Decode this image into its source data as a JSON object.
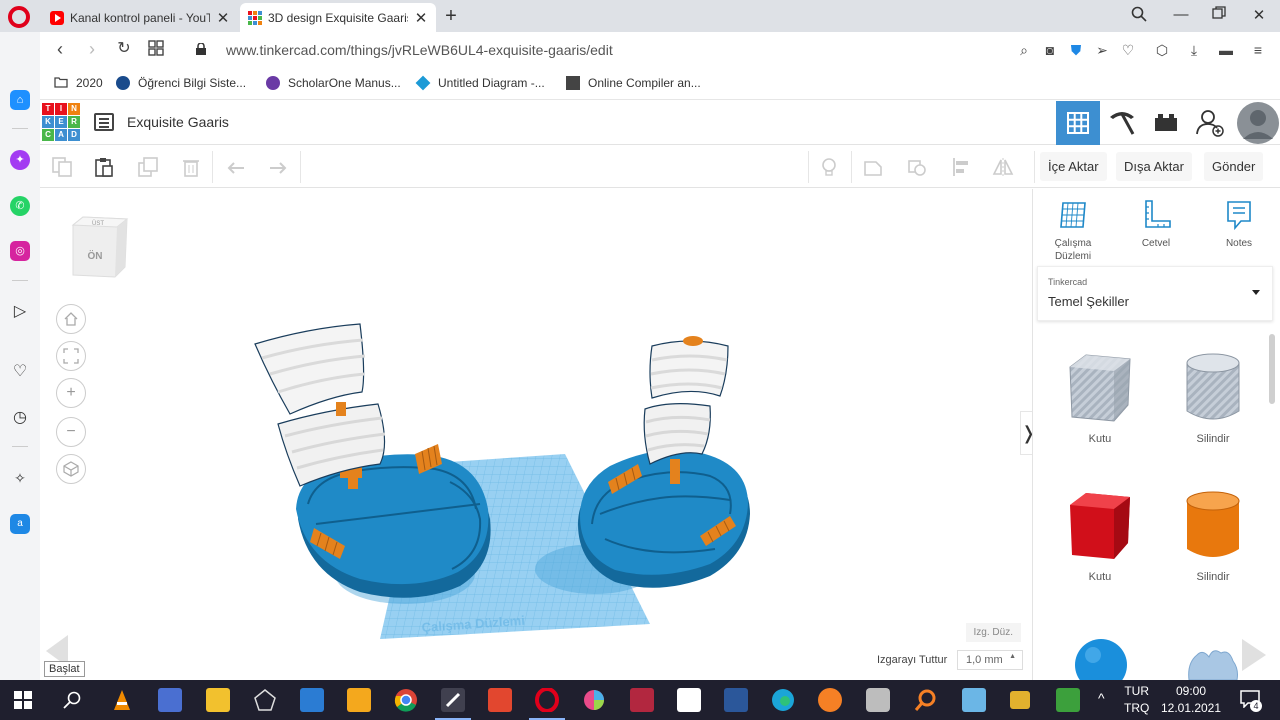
{
  "browser": {
    "tabs": [
      {
        "title": "Kanal kontrol paneli - YouT",
        "active": false
      },
      {
        "title": "3D design Exquisite Gaaris",
        "active": true
      }
    ],
    "url": "www.tinkercad.com/things/jvRLeWB6UL4-exquisite-gaaris/edit",
    "bookmarks": [
      {
        "label": "2020"
      },
      {
        "label": "Öğrenci Bilgi Siste..."
      },
      {
        "label": "ScholarOne Manus..."
      },
      {
        "label": "Untitled Diagram -..."
      },
      {
        "label": "Online Compiler an..."
      }
    ]
  },
  "app": {
    "logo_letters": [
      "T",
      "I",
      "N",
      "K",
      "E",
      "R",
      "C",
      "A",
      "D"
    ],
    "design_title": "Exquisite Gaaris",
    "toolbar": {
      "import_label": "İçe Aktar",
      "export_label": "Dışa Aktar",
      "send_label": "Gönder"
    },
    "view_cube": {
      "top_face": "ÜST",
      "front_face": "ÖN"
    },
    "workplane_text": "Çalışma Düzlemi",
    "edit_grid_label": "Izg. Düz.",
    "snap_grid_label": "Izgarayı Tuttur",
    "snap_grid_value": "1,0 mm",
    "start_label": "Başlat",
    "collapse_glyph": "❭"
  },
  "panel": {
    "tools": [
      {
        "label_line1": "Çalışma",
        "label_line2": "Düzlemi"
      },
      {
        "label_line1": "Cetvel",
        "label_line2": ""
      },
      {
        "label_line1": "Notes",
        "label_line2": ""
      }
    ],
    "library_small": "Tinkercad",
    "library_name": "Temel Şekiller",
    "shapes": [
      {
        "label": "Kutu",
        "kind": "box",
        "color": "#b9c3cf"
      },
      {
        "label": "Silindir",
        "kind": "cylinder",
        "color": "#b9c3cf"
      },
      {
        "label": "Kutu",
        "kind": "box",
        "color": "#e8111d"
      },
      {
        "label": "Silindir",
        "kind": "cylinder",
        "color": "#f0820f"
      }
    ]
  },
  "taskbar": {
    "lang_top": "TUR",
    "lang_bottom": "TRQ",
    "time": "09:00",
    "date": "12.01.2021",
    "notifications": "4"
  },
  "colors": {
    "accent": "#3d8fd1",
    "boat_blue": "#1f8ac7",
    "orange": "#e4821d",
    "grid_blue": "#8ccbf0"
  }
}
